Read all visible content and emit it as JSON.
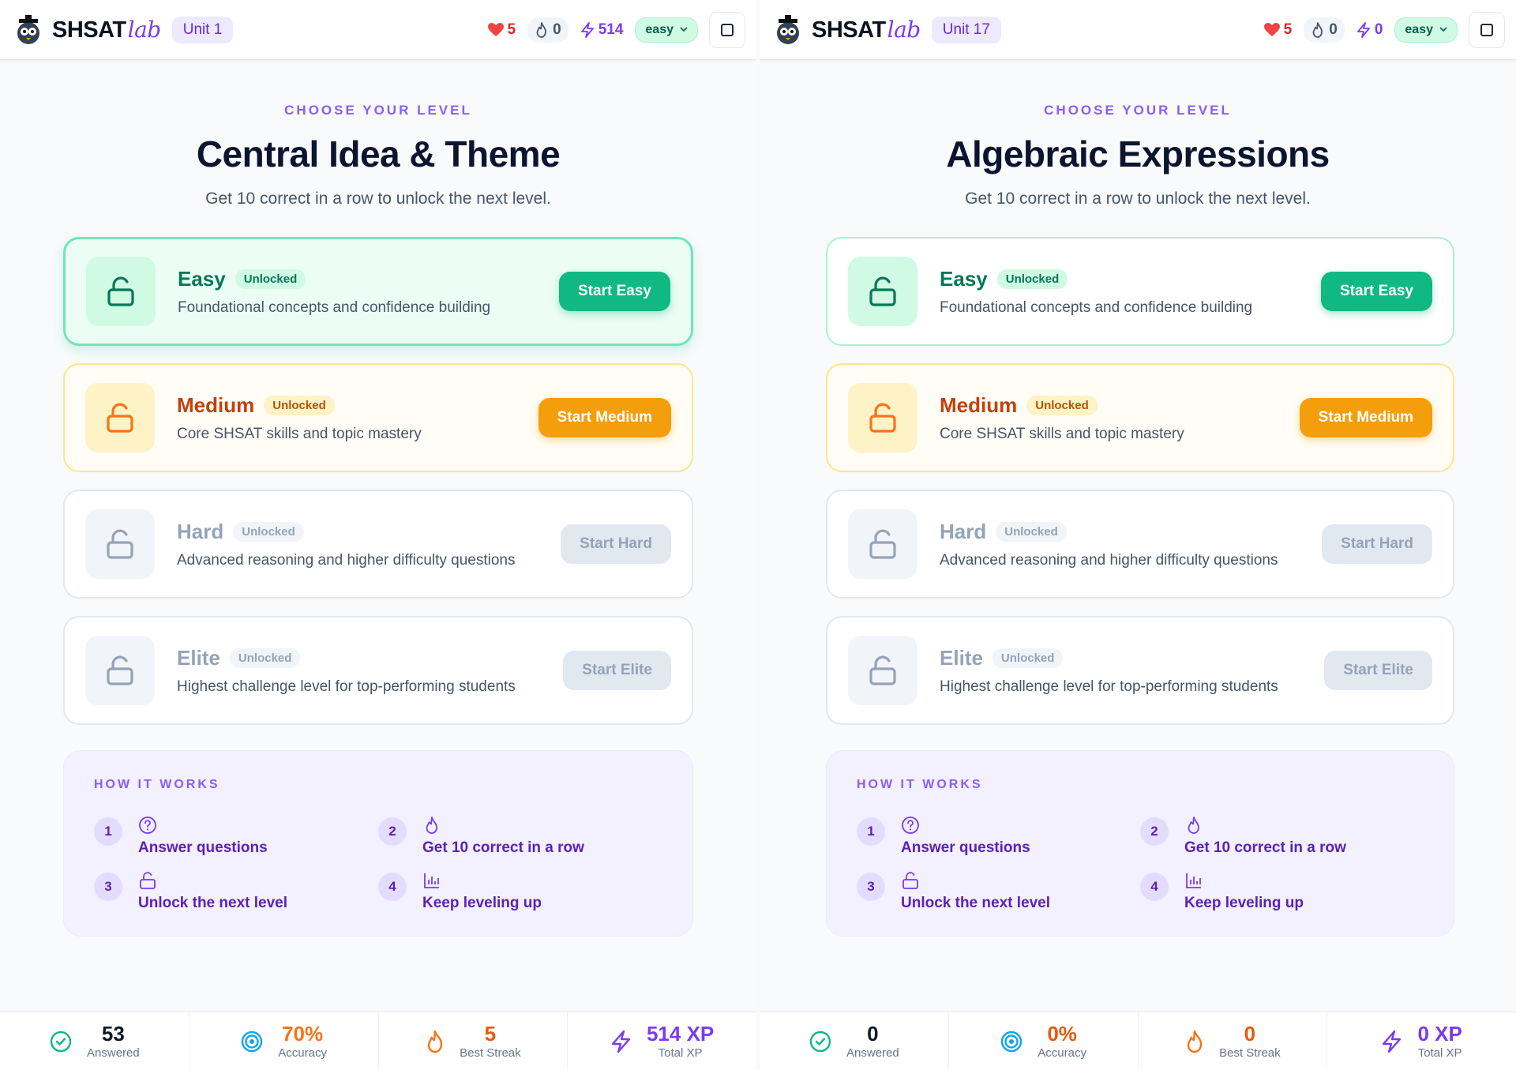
{
  "panels": [
    {
      "brand": {
        "main": "SHSAT",
        "lab": "lab"
      },
      "unit": "Unit 1",
      "stats": {
        "hearts": "5",
        "streak": "0",
        "xp": "514"
      },
      "difficulty": "easy",
      "eyebrow": "CHOOSE YOUR LEVEL",
      "title": "Central Idea & Theme",
      "subtitle": "Get 10 correct in a row to unlock the next level.",
      "levels": [
        {
          "name": "Easy",
          "badge": "Unlocked",
          "desc": "Foundational concepts and confidence building",
          "button": "Start Easy"
        },
        {
          "name": "Medium",
          "badge": "Unlocked",
          "desc": "Core SHSAT skills and topic mastery",
          "button": "Start Medium"
        },
        {
          "name": "Hard",
          "badge": "Unlocked",
          "desc": "Advanced reasoning and higher difficulty questions",
          "button": "Start Hard"
        },
        {
          "name": "Elite",
          "badge": "Unlocked",
          "desc": "Highest challenge level for top-performing students",
          "button": "Start Elite"
        }
      ],
      "how": {
        "title": "HOW IT WORKS",
        "steps": [
          {
            "num": "1",
            "text": "Answer questions"
          },
          {
            "num": "2",
            "text": "Get 10 correct in a row"
          },
          {
            "num": "3",
            "text": "Unlock the next level"
          },
          {
            "num": "4",
            "text": "Keep leveling up"
          }
        ]
      },
      "bottom": [
        {
          "value": "53",
          "label": "Answered"
        },
        {
          "value": "70%",
          "label": "Accuracy"
        },
        {
          "value": "5",
          "label": "Best Streak"
        },
        {
          "value": "514 XP",
          "label": "Total XP"
        }
      ]
    },
    {
      "brand": {
        "main": "SHSAT",
        "lab": "lab"
      },
      "unit": "Unit 17",
      "stats": {
        "hearts": "5",
        "streak": "0",
        "xp": "0"
      },
      "difficulty": "easy",
      "eyebrow": "CHOOSE YOUR LEVEL",
      "title": "Algebraic Expressions",
      "subtitle": "Get 10 correct in a row to unlock the next level.",
      "levels": [
        {
          "name": "Easy",
          "badge": "Unlocked",
          "desc": "Foundational concepts and confidence building",
          "button": "Start Easy"
        },
        {
          "name": "Medium",
          "badge": "Unlocked",
          "desc": "Core SHSAT skills and topic mastery",
          "button": "Start Medium"
        },
        {
          "name": "Hard",
          "badge": "Unlocked",
          "desc": "Advanced reasoning and higher difficulty questions",
          "button": "Start Hard"
        },
        {
          "name": "Elite",
          "badge": "Unlocked",
          "desc": "Highest challenge level for top-performing students",
          "button": "Start Elite"
        }
      ],
      "how": {
        "title": "HOW IT WORKS",
        "steps": [
          {
            "num": "1",
            "text": "Answer questions"
          },
          {
            "num": "2",
            "text": "Get 10 correct in a row"
          },
          {
            "num": "3",
            "text": "Unlock the next level"
          },
          {
            "num": "4",
            "text": "Keep leveling up"
          }
        ]
      },
      "bottom": [
        {
          "value": "0",
          "label": "Answered"
        },
        {
          "value": "0%",
          "label": "Accuracy"
        },
        {
          "value": "0",
          "label": "Best Streak"
        },
        {
          "value": "0 XP",
          "label": "Total XP"
        }
      ]
    }
  ],
  "colors": {
    "easy": "#10b981",
    "medium": "#f59e0b",
    "locked": "#94a3b8",
    "accent": "#7c3aed"
  },
  "icons": [
    "heart-icon",
    "flame-icon",
    "bolt-icon",
    "chevron-down-icon",
    "unlock-icon",
    "question-circle-icon",
    "bar-chart-icon",
    "check-circle-icon",
    "target-icon"
  ]
}
